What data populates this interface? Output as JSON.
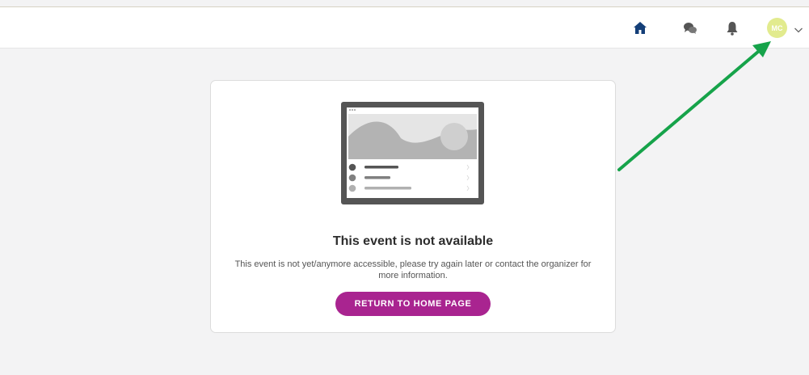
{
  "header": {
    "home_icon": "home-icon",
    "chat_icon": "chat-bubbles-icon",
    "bell_icon": "bell-icon",
    "avatar_initials": "MC",
    "avatar_color": "#e2eb8e",
    "dropdown_icon": "chevron-down-icon",
    "icon_color": "#143f78",
    "gray_icon_color": "#555555"
  },
  "message": {
    "title": "This event is not available",
    "description": "This event is not yet/anymore accessible, please try again later or contact the organizer for more information.",
    "button_label": "RETURN TO HOME PAGE",
    "button_color": "#a92490"
  },
  "annotation": {
    "arrow_color": "#16a34a"
  }
}
